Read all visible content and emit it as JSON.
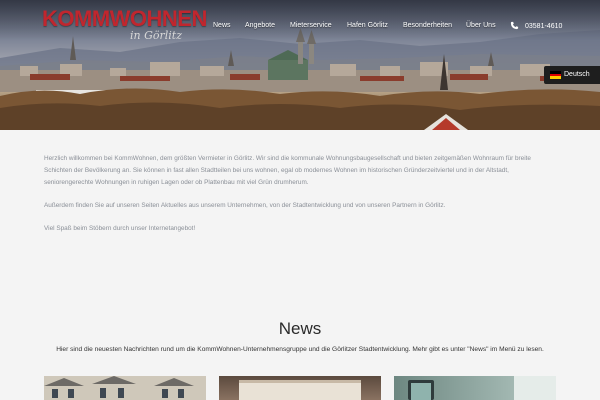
{
  "header": {
    "logo_main_a": "KOMM",
    "logo_main_b": "WOHNEN",
    "logo_sub": "in Görlitz",
    "nav": [
      "News",
      "Angebote",
      "Mieterservice",
      "Hafen Görlitz",
      "Besonderheiten",
      "Über Uns"
    ],
    "phone": "03581-4610",
    "language": "Deutsch"
  },
  "intro": {
    "p1": "Herzlich willkommen bei KommWohnen, dem größten Vermieter in Görlitz. Wir sind die kommunale Wohnungsbaugesellschaft und bieten zeitgemäßen Wohnraum für breite Schichten der Bevölkerung an. Sie können in fast allen Stadtteilen bei uns wohnen, egal ob modernes Wohnen im historischen Gründerzeitviertel und in der Altstadt, seniorengerechte Wohnungen in ruhigen Lagen oder ob Plattenbau mit viel Grün drumherum.",
    "p2": "Außerdem finden Sie auf unseren Seiten Aktuelles aus unserem Unternehmen, von der Stadtentwicklung und von unseren Partnern in Görlitz.",
    "p3": "Viel Spaß beim Stöbern durch unser Internetangebot!"
  },
  "news": {
    "title": "News",
    "subtitle": "Hier sind die neuesten Nachrichten rund um die KommWohnen-Unternehmensgruppe und die Görlitzer Stadtentwicklung. Mehr gibt es unter \"News\" im Menü zu lesen."
  },
  "colors": {
    "brand_red": "#c0262e",
    "text_gray": "#8a8f97",
    "lang_bg": "#1e1e1e"
  },
  "icons": [
    "phone-icon",
    "german-flag-icon"
  ]
}
